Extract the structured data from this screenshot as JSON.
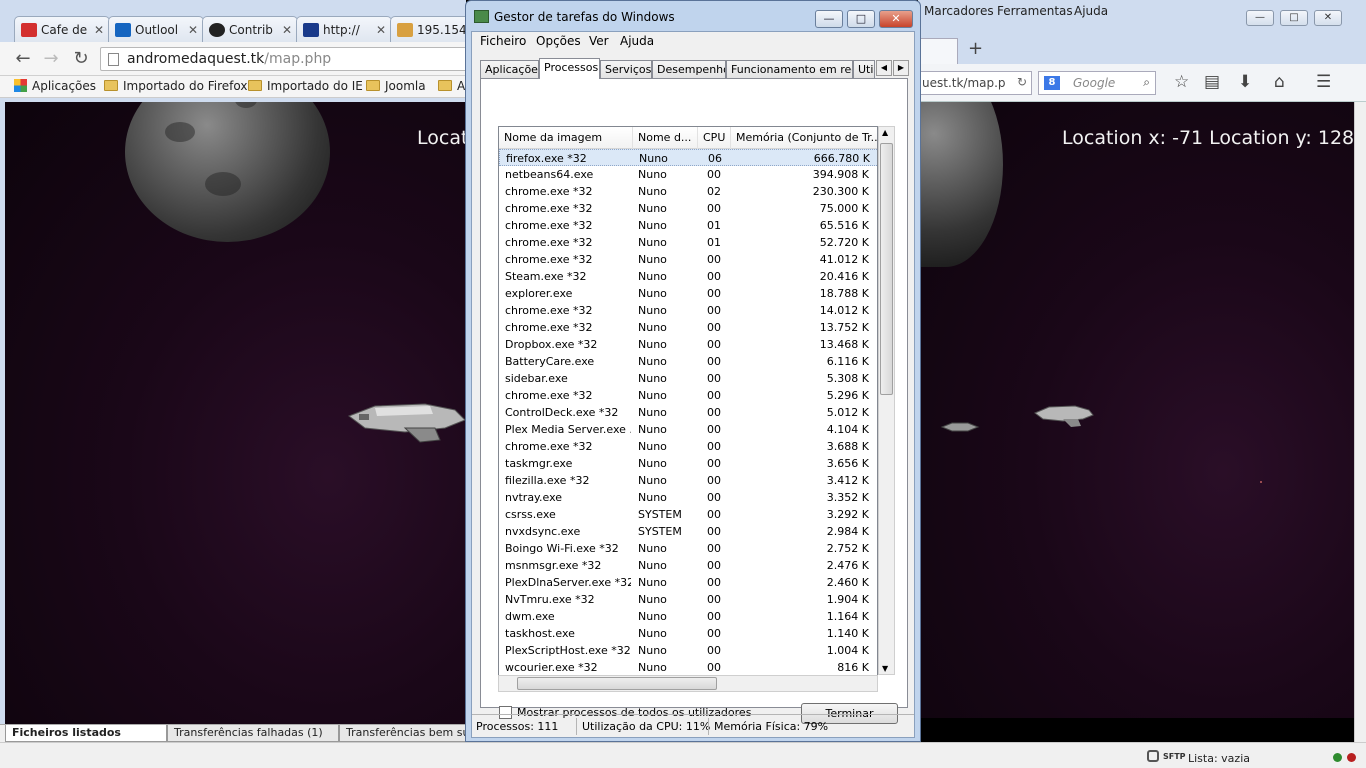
{
  "chrome": {
    "tabs": [
      {
        "label": "Cafe de",
        "color": "#d32f2f"
      },
      {
        "label": "Outlool",
        "color": "#1565c0"
      },
      {
        "label": "Contrib",
        "color": "#222222"
      },
      {
        "label": "http://",
        "color": "#1a3a8a"
      },
      {
        "label": "195.154",
        "color": "#d8a040"
      }
    ],
    "tab_close": "✕",
    "back": "←",
    "forward": "→",
    "reload": "↻",
    "url_domain": "andromedaquest.tk",
    "url_path": "/map.php",
    "bookmarks": [
      "Aplicações",
      "Importado do Firefox",
      "Importado do IE",
      "Joomla",
      "A"
    ]
  },
  "game": {
    "left_location": "Locat",
    "right_location": "Location x: -71 Location y: 128"
  },
  "filezilla": {
    "tabs": [
      "Ficheiros listados",
      "Transferências falhadas (1)",
      "Transferências bem suce"
    ],
    "status": "Lista: vazia",
    "sftp": "SFTP"
  },
  "firefox": {
    "menu": [
      "Marcadores",
      "Ferramentas",
      "Ajuda"
    ],
    "new_tab": "+",
    "url": "uest.tk/map.p",
    "search_placeholder": "Google",
    "g": "8",
    "win_min": "—",
    "win_max": "□",
    "win_close": "✕"
  },
  "taskmanager": {
    "title": "Gestor de tarefas do Windows",
    "menu": [
      "Ficheiro",
      "Opções",
      "Ver",
      "Ajuda"
    ],
    "tabs": [
      "Aplicações",
      "Processos",
      "Serviços",
      "Desempenho",
      "Funcionamento em rede",
      "Util"
    ],
    "active_tab": 1,
    "columns": [
      "Nome da imagem",
      "Nome d...",
      "CPU",
      "Memória (Conjunto de Tr..."
    ],
    "processes": [
      [
        "firefox.exe *32",
        "Nuno",
        "06",
        "666.780 K"
      ],
      [
        "netbeans64.exe",
        "Nuno",
        "00",
        "394.908 K"
      ],
      [
        "chrome.exe *32",
        "Nuno",
        "02",
        "230.300 K"
      ],
      [
        "chrome.exe *32",
        "Nuno",
        "00",
        "75.000 K"
      ],
      [
        "chrome.exe *32",
        "Nuno",
        "01",
        "65.516 K"
      ],
      [
        "chrome.exe *32",
        "Nuno",
        "01",
        "52.720 K"
      ],
      [
        "chrome.exe *32",
        "Nuno",
        "00",
        "41.012 K"
      ],
      [
        "Steam.exe *32",
        "Nuno",
        "00",
        "20.416 K"
      ],
      [
        "explorer.exe",
        "Nuno",
        "00",
        "18.788 K"
      ],
      [
        "chrome.exe *32",
        "Nuno",
        "00",
        "14.012 K"
      ],
      [
        "chrome.exe *32",
        "Nuno",
        "00",
        "13.752 K"
      ],
      [
        "Dropbox.exe *32",
        "Nuno",
        "00",
        "13.468 K"
      ],
      [
        "BatteryCare.exe",
        "Nuno",
        "00",
        "6.116 K"
      ],
      [
        "sidebar.exe",
        "Nuno",
        "00",
        "5.308 K"
      ],
      [
        "chrome.exe *32",
        "Nuno",
        "00",
        "5.296 K"
      ],
      [
        "ControlDeck.exe *32",
        "Nuno",
        "00",
        "5.012 K"
      ],
      [
        "Plex Media Server.exe ...",
        "Nuno",
        "00",
        "4.104 K"
      ],
      [
        "chrome.exe *32",
        "Nuno",
        "00",
        "3.688 K"
      ],
      [
        "taskmgr.exe",
        "Nuno",
        "00",
        "3.656 K"
      ],
      [
        "filezilla.exe *32",
        "Nuno",
        "00",
        "3.412 K"
      ],
      [
        "nvtray.exe",
        "Nuno",
        "00",
        "3.352 K"
      ],
      [
        "csrss.exe",
        "SYSTEM",
        "00",
        "3.292 K"
      ],
      [
        "nvxdsync.exe",
        "SYSTEM",
        "00",
        "2.984 K"
      ],
      [
        "Boingo Wi-Fi.exe *32",
        "Nuno",
        "00",
        "2.752 K"
      ],
      [
        "msnmsgr.exe *32",
        "Nuno",
        "00",
        "2.476 K"
      ],
      [
        "PlexDlnaServer.exe *32",
        "Nuno",
        "00",
        "2.460 K"
      ],
      [
        "NvTmru.exe *32",
        "Nuno",
        "00",
        "1.904 K"
      ],
      [
        "dwm.exe",
        "Nuno",
        "00",
        "1.164 K"
      ],
      [
        "taskhost.exe",
        "Nuno",
        "00",
        "1.140 K"
      ],
      [
        "PlexScriptHost.exe *32",
        "Nuno",
        "00",
        "1.004 K"
      ],
      [
        "wcourier.exe *32",
        "Nuno",
        "00",
        "816 K"
      ]
    ],
    "show_all_label": "Mostrar processos de todos os utilizadores",
    "end_button": "Terminar",
    "status_processes": "Processos: 111",
    "status_cpu": "Utilização da CPU: 11%",
    "status_memory": "Memória Física: 79%",
    "btn_min": "—",
    "btn_max": "□",
    "btn_close": "✕"
  }
}
